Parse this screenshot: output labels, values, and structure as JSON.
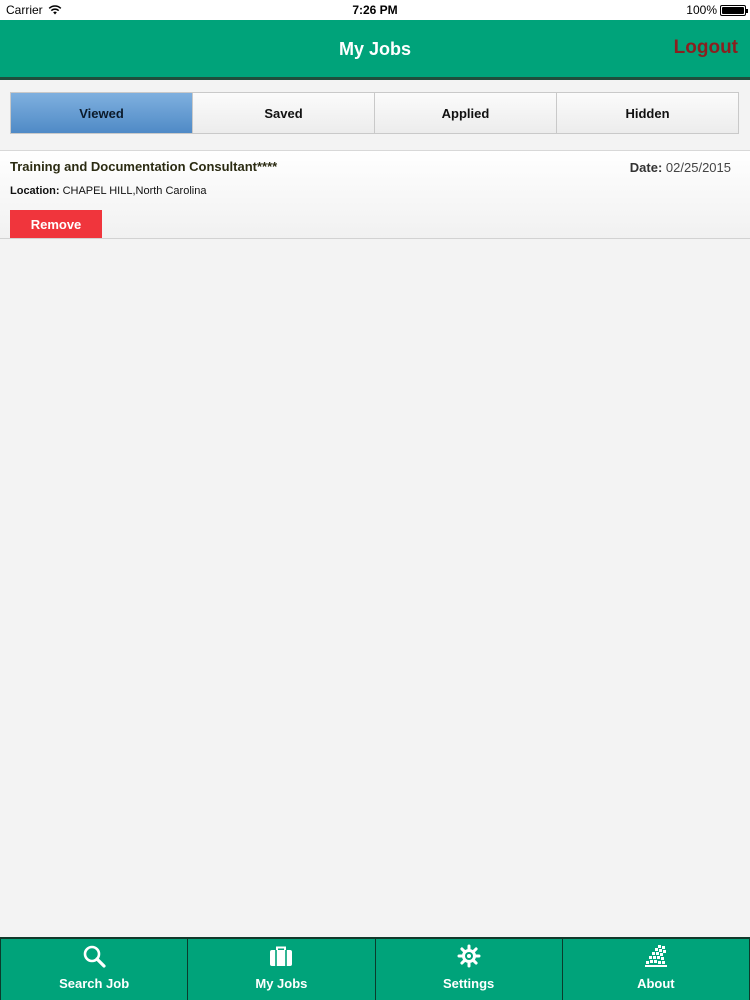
{
  "status_bar": {
    "carrier": "Carrier",
    "time": "7:26 PM",
    "battery": "100%"
  },
  "nav": {
    "title": "My Jobs",
    "logout_label": "Logout"
  },
  "tabs": [
    {
      "label": "Viewed",
      "active": true
    },
    {
      "label": "Saved",
      "active": false
    },
    {
      "label": "Applied",
      "active": false
    },
    {
      "label": "Hidden",
      "active": false
    }
  ],
  "jobs": [
    {
      "title": "Training and Documentation Consultant****",
      "date_label": "Date:",
      "date": "02/25/2015",
      "location_label": "Location:",
      "location": "CHAPEL HILL,North Carolina",
      "remove_label": "Remove"
    }
  ],
  "tab_bar": [
    {
      "label": "Search Job",
      "icon": "search-icon"
    },
    {
      "label": "My Jobs",
      "icon": "briefcase-icon"
    },
    {
      "label": "Settings",
      "icon": "gear-icon"
    },
    {
      "label": "About",
      "icon": "about-logo-icon"
    }
  ],
  "colors": {
    "brand_green": "#00a37a",
    "active_tab_blue": "#4f8ac6",
    "remove_red": "#f0353c",
    "logout_red": "#8a1f1f"
  }
}
